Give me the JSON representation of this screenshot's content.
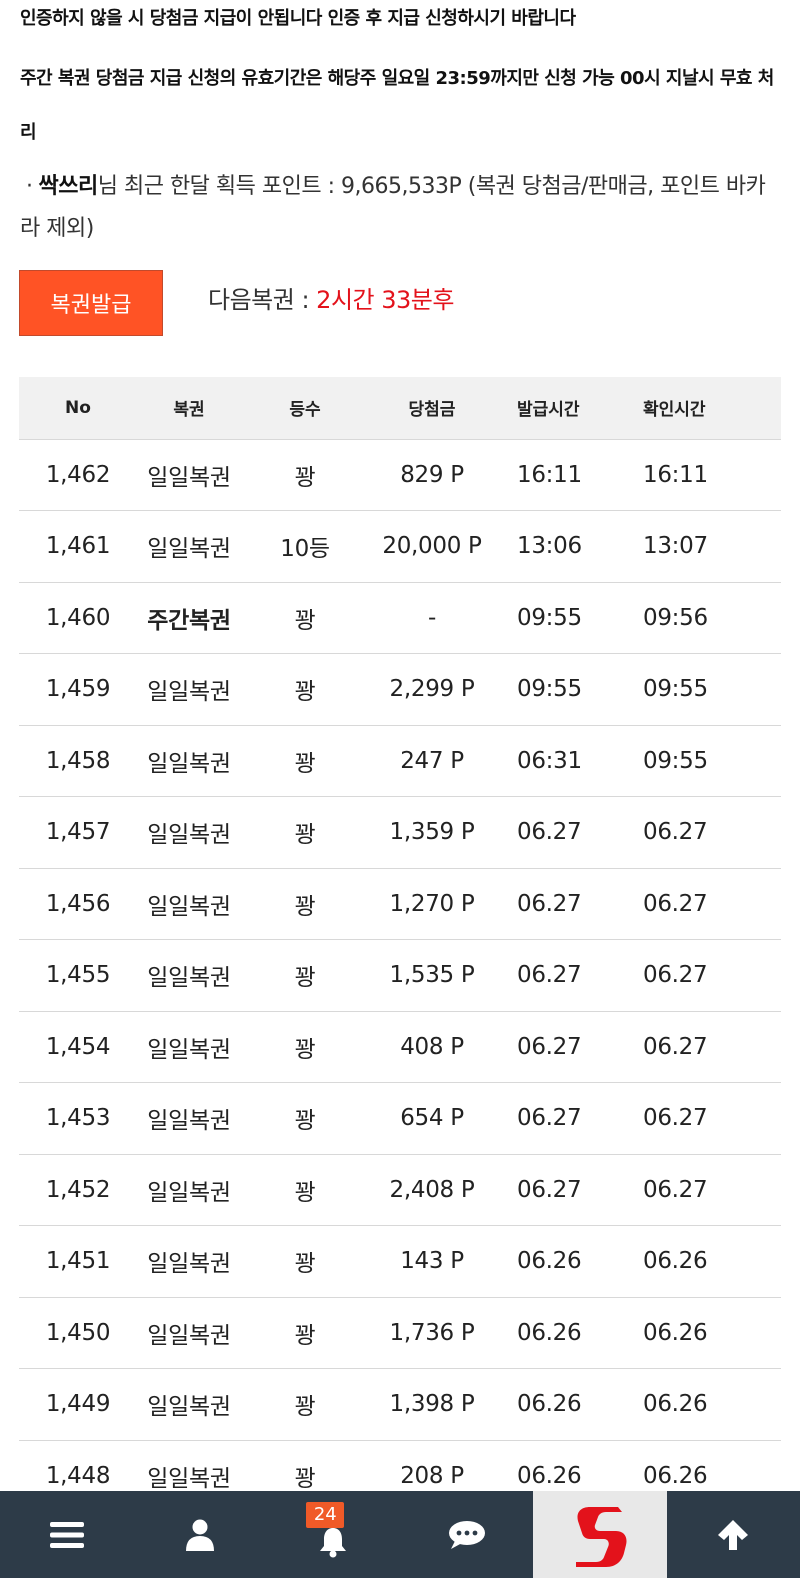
{
  "notices": {
    "line1": "인증하지 않을 시 당첨금 지급이 안됩니다 인증 후 지급 신청하시기 바랍니다",
    "line2": "주간 복권 당첨금 지급 신청의 유효기간은 해당주 일요일 23:59까지만 신청 가능 00시 지날시 무효 처리"
  },
  "points": {
    "bullet": "·",
    "username": "싹쓰리",
    "text": "님 최근 한달 획득 포인트 : 9,665,533P (복권 당첨금/판매금, 포인트 바카라 제외)"
  },
  "issue_button": {
    "label": "복권발급"
  },
  "next_ticket": {
    "label": "다음복권 : ",
    "remaining": "2시간 33분후"
  },
  "table": {
    "headers": [
      "No",
      "복권",
      "등수",
      "당첨금",
      "발급시간",
      "확인시간"
    ],
    "rows": [
      [
        "1,462",
        "일일복권",
        "꽝",
        "829 P",
        "16:11",
        "16:11"
      ],
      [
        "1,461",
        "일일복권",
        "10등",
        "20,000 P",
        "13:06",
        "13:07"
      ],
      [
        "1,460",
        "주간복권",
        "꽝",
        "-",
        "09:55",
        "09:56"
      ],
      [
        "1,459",
        "일일복권",
        "꽝",
        "2,299 P",
        "09:55",
        "09:55"
      ],
      [
        "1,458",
        "일일복권",
        "꽝",
        "247 P",
        "06:31",
        "09:55"
      ],
      [
        "1,457",
        "일일복권",
        "꽝",
        "1,359 P",
        "06.27",
        "06.27"
      ],
      [
        "1,456",
        "일일복권",
        "꽝",
        "1,270 P",
        "06.27",
        "06.27"
      ],
      [
        "1,455",
        "일일복권",
        "꽝",
        "1,535 P",
        "06.27",
        "06.27"
      ],
      [
        "1,454",
        "일일복권",
        "꽝",
        "408 P",
        "06.27",
        "06.27"
      ],
      [
        "1,453",
        "일일복권",
        "꽝",
        "654 P",
        "06.27",
        "06.27"
      ],
      [
        "1,452",
        "일일복권",
        "꽝",
        "2,408 P",
        "06.27",
        "06.27"
      ],
      [
        "1,451",
        "일일복권",
        "꽝",
        "143 P",
        "06.26",
        "06.26"
      ],
      [
        "1,450",
        "일일복권",
        "꽝",
        "1,736 P",
        "06.26",
        "06.26"
      ],
      [
        "1,449",
        "일일복권",
        "꽝",
        "1,398 P",
        "06.26",
        "06.26"
      ],
      [
        "1,448",
        "일일복권",
        "꽝",
        "208 P",
        "06.26",
        "06.26"
      ]
    ]
  },
  "bottom_nav": {
    "items": [
      {
        "icon": "menu-icon"
      },
      {
        "icon": "user-icon"
      },
      {
        "icon": "bell-icon",
        "badge": "24"
      },
      {
        "icon": "chat-icon"
      },
      {
        "icon": "site-logo"
      },
      {
        "icon": "arrow-up-icon"
      }
    ]
  },
  "colors": {
    "issue_button": "#ff5325",
    "remaining_time": "#e3121b",
    "bottom_bar": "#2d3b48",
    "badge": "#f05a28",
    "logo_red": "#e3121b"
  }
}
